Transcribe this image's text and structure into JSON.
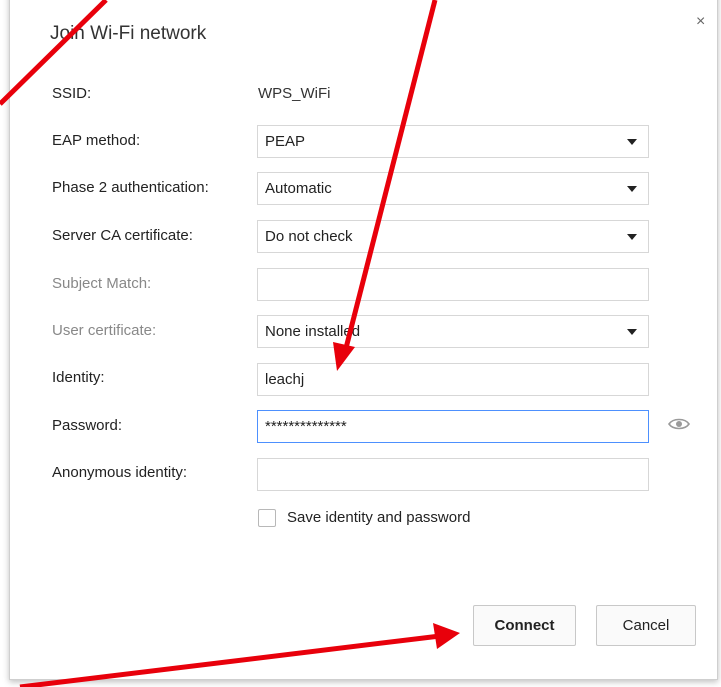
{
  "dialog": {
    "title": "Join Wi-Fi network",
    "close_symbol": "×"
  },
  "form": {
    "ssid": {
      "label": "SSID:",
      "value": "WPS_WiFi"
    },
    "eap_method": {
      "label": "EAP method:",
      "value": "PEAP"
    },
    "phase2": {
      "label": "Phase 2 authentication:",
      "value": "Automatic"
    },
    "server_ca": {
      "label": "Server CA certificate:",
      "value": "Do not check"
    },
    "subject_match": {
      "label": "Subject Match:",
      "value": ""
    },
    "user_certificate": {
      "label": "User certificate:",
      "value": "None installed"
    },
    "identity": {
      "label": "Identity:",
      "value": "leachj"
    },
    "password": {
      "label": "Password:",
      "value": "**************"
    },
    "anonymous_identity": {
      "label": "Anonymous identity:",
      "value": ""
    },
    "save_checkbox": {
      "label": "Save identity and password",
      "checked": false
    }
  },
  "buttons": {
    "connect": "Connect",
    "cancel": "Cancel"
  },
  "icons": {
    "close": "close-icon",
    "show_password": "eye-icon",
    "dropdown": "caret-down-icon"
  },
  "colors": {
    "annotation_arrow": "#e8000b",
    "focus_border": "#4d90fe",
    "disabled_label": "#888888"
  }
}
